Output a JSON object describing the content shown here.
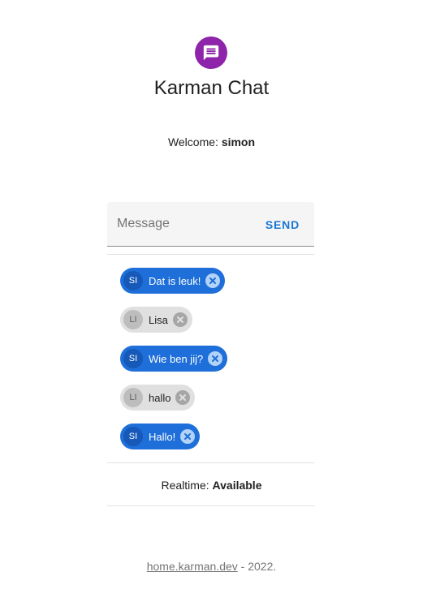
{
  "app": {
    "title": "Karman Chat",
    "icon": "chat-bubble-icon",
    "accent_color": "#8e24aa"
  },
  "welcome": {
    "label": "Welcome:",
    "user": "simon"
  },
  "composer": {
    "placeholder": "Message",
    "value": "",
    "send_label": "SEND"
  },
  "messages": [
    {
      "initials": "SI",
      "text": "Dat is leuk!",
      "self": true
    },
    {
      "initials": "LI",
      "text": "Lisa",
      "self": false
    },
    {
      "initials": "SI",
      "text": "Wie ben jij?",
      "self": true
    },
    {
      "initials": "LI",
      "text": "hallo",
      "self": false
    },
    {
      "initials": "SI",
      "text": "Hallo!",
      "self": true
    }
  ],
  "realtime": {
    "label": "Realtime:",
    "status": "Available"
  },
  "footer": {
    "link_text": "home.karman.dev",
    "suffix": " - 2022."
  },
  "colors": {
    "self_chip": "#1e6fd9",
    "other_chip": "#e0e0e0",
    "send": "#1976d2"
  }
}
